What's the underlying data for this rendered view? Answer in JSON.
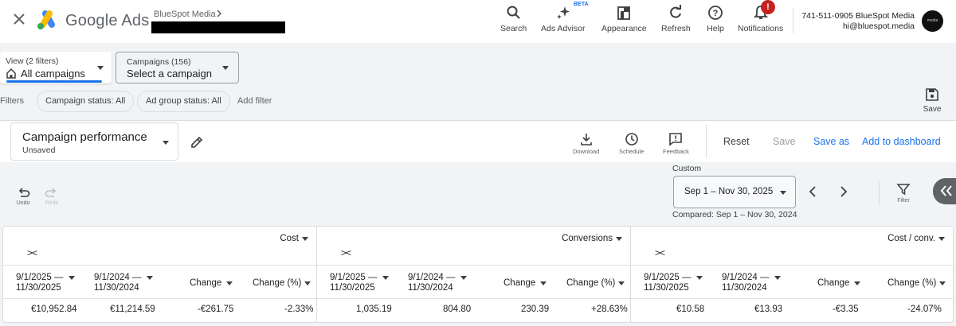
{
  "topbar": {
    "brand": "Google Ads",
    "account_name": "BlueSpot Media",
    "tools": [
      {
        "label": "Search",
        "icon": "search-icon"
      },
      {
        "label": "Ads Advisor",
        "icon": "sparkle-icon"
      },
      {
        "label": "Appearance",
        "icon": "appearance-icon"
      },
      {
        "label": "Refresh",
        "icon": "refresh-icon"
      },
      {
        "label": "Help",
        "icon": "help-icon"
      },
      {
        "label": "Notifications",
        "icon": "bell-icon"
      }
    ],
    "beta_label": "BETA",
    "notification_count": "!",
    "account_line1": "741-511-0905 BlueSpot Media",
    "account_line2": "hi@bluespot.media",
    "avatar_text": "media"
  },
  "filters": {
    "view_label": "View (2 filters)",
    "view_value": "All campaigns",
    "campaigns_label": "Campaigns (156)",
    "campaigns_value": "Select a campaign",
    "filters_label": "Filters",
    "chips": [
      "Campaign status: All",
      "Ad group status: All"
    ],
    "add_filter": "Add filter",
    "save_label": "Save"
  },
  "report": {
    "title": "Campaign performance",
    "subtitle": "Unsaved",
    "tools": [
      {
        "label": "Download",
        "icon": "download-icon"
      },
      {
        "label": "Schedule",
        "icon": "clock-icon"
      },
      {
        "label": "Feedback",
        "icon": "feedback-icon"
      }
    ],
    "reset": "Reset",
    "save": "Save",
    "save_as": "Save as",
    "add_to_dashboard": "Add to dashboard"
  },
  "controls": {
    "undo": "Undo",
    "redo": "Redo",
    "custom_label": "Custom",
    "date_range": "Sep 1 – Nov 30, 2025",
    "compared": "Compared: Sep 1 – Nov 30, 2024",
    "filter": "Filter"
  },
  "table": {
    "groups": [
      {
        "title": "Cost",
        "cols": [
          "9/1/2025 —\n11/30/2025",
          "9/1/2024 —\n11/30/2024",
          "Change",
          "Change (%)"
        ],
        "values": [
          "€10,952.84",
          "€11,214.59",
          "-€261.75",
          "-2.33%"
        ]
      },
      {
        "title": "Conversions",
        "cols": [
          "9/1/2025 —\n11/30/2025",
          "9/1/2024 —\n11/30/2024",
          "Change",
          "Change (%)"
        ],
        "values": [
          "1,035.19",
          "804.80",
          "230.39",
          "+28.63%"
        ]
      },
      {
        "title": "Cost / conv.",
        "cols": [
          "9/1/2025 —\n11/30/2025",
          "9/1/2024 —\n11/30/2024",
          "Change",
          "Change (%)"
        ],
        "values": [
          "€10.58",
          "€13.93",
          "-€3.35",
          "-24.07%"
        ]
      }
    ]
  },
  "colors": {
    "accent": "#1a73e8",
    "badge": "#c5221f",
    "disabled": "#9aa0a6"
  }
}
